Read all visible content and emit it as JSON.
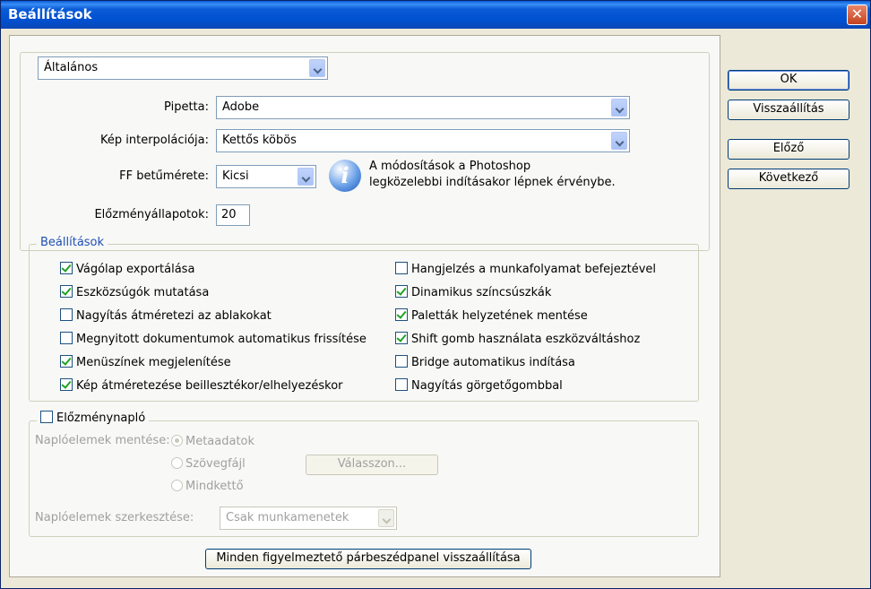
{
  "window": {
    "title": "Beállítások",
    "close_icon": "close-icon"
  },
  "category": {
    "selected": "Általános"
  },
  "general": {
    "pipette_label": "Pipetta:",
    "pipette_value": "Adobe",
    "interp_label": "Kép interpolációja:",
    "interp_value": "Kettős köbös",
    "font_label": "FF betűmérete:",
    "font_value": "Kicsi",
    "info_text_1": "A módosítások a Photoshop",
    "info_text_2": "legközelebbi indításakor lépnek érvénybe.",
    "history_states_label": "Előzményállapotok:",
    "history_states_value": "20"
  },
  "options": {
    "legend": "Beállítások",
    "left": [
      {
        "label": "Vágólap exportálása",
        "checked": true
      },
      {
        "label": "Eszközsúgók mutatása",
        "checked": true
      },
      {
        "label": "Nagyítás átméretezi az ablakokat",
        "checked": false
      },
      {
        "label": "Megnyitott dokumentumok automatikus frissítése",
        "checked": false
      },
      {
        "label": "Menüszínek megjelenítése",
        "checked": true
      },
      {
        "label": "Kép átméretezése beillesztékor/elhelyezéskor",
        "checked": true
      }
    ],
    "right": [
      {
        "label": "Hangjelzés a munkafolyamat befejeztével",
        "checked": false
      },
      {
        "label": "Dinamikus színcsúszkák",
        "checked": true
      },
      {
        "label": "Paletták helyzetének mentése",
        "checked": true
      },
      {
        "label": "Shift gomb használata eszközváltáshoz",
        "checked": true
      },
      {
        "label": "Bridge automatikus indítása",
        "checked": false
      },
      {
        "label": "Nagyítás görgetőgombbal",
        "checked": false
      }
    ]
  },
  "history_log": {
    "legend": "Előzménynapló",
    "save_label": "Naplóelemek mentése:",
    "radio_1": "Metaadatok",
    "radio_2": "Szövegfájl",
    "radio_3": "Mindkettő",
    "choose_button": "Válasszon...",
    "edit_label": "Naplóelemek szerkesztése:",
    "edit_value": "Csak munkamenetek"
  },
  "reset_warnings_button": "Minden figyelmeztető párbeszédpanel visszaállítása",
  "buttons": {
    "ok": "OK",
    "reset": "Visszaállítás",
    "prev": "Előző",
    "next": "Következő"
  }
}
